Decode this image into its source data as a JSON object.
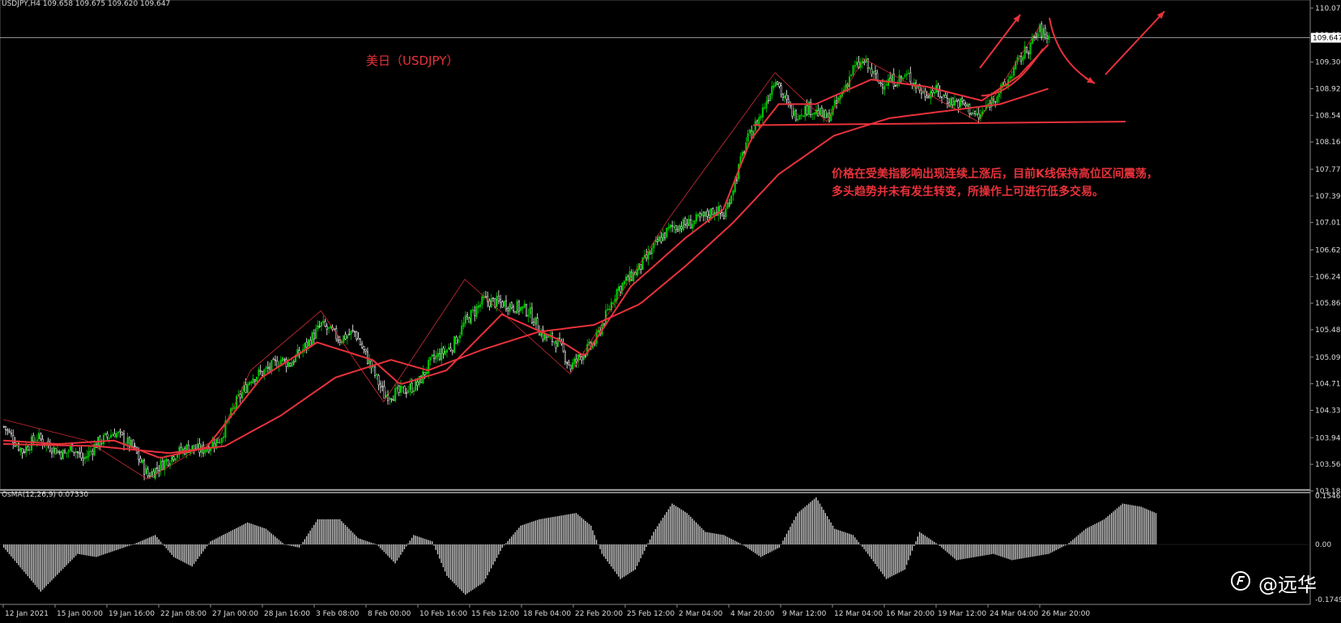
{
  "header": {
    "symbol_line": "USDJPY,H4  109.658 109.675 109.620 109.647",
    "oscillator_line": "OsMA(12,26,9) 0.07330"
  },
  "annotations": {
    "title": "美日（USDJPY）",
    "note_line_1": "价格在受美指影响出现连续上涨后，目前K线保持高位区间震荡，",
    "note_line_2": "多头趋势并未有发生转变，所操作上可进行低多交易。"
  },
  "watermark": {
    "text": "@远华"
  },
  "colors": {
    "background": "#000000",
    "bull_candle": "#00c800",
    "bear_candle": "#ffffff",
    "moving_average": "#e8323b",
    "annotation": "#e8323b",
    "histogram": "#c8c8c8",
    "price_line": "#c0c0c0"
  },
  "chart_data": [
    {
      "type": "candlestick",
      "title": "USDJPY,H4",
      "timeframe": "H4",
      "last_quote": {
        "open": 109.658,
        "high": 109.675,
        "low": 109.62,
        "close": 109.647
      },
      "current_price_label": "109.647",
      "ylim": [
        103.18,
        110.07
      ],
      "y_ticks": [
        "110.070",
        "109.690",
        "109.300",
        "108.920",
        "108.540",
        "108.160",
        "107.770",
        "107.390",
        "107.010",
        "106.620",
        "106.240",
        "105.860",
        "105.480",
        "105.090",
        "104.710",
        "104.330",
        "103.940",
        "103.560",
        "103.180"
      ],
      "x_ticks": [
        "12 Jan 2021",
        "15 Jan 00:00",
        "19 Jan 16:00",
        "22 Jan 08:00",
        "27 Jan 00:00",
        "28 Jan 16:00",
        "3 Feb 08:00",
        "8 Feb 00:00",
        "10 Feb 16:00",
        "15 Feb 12:00",
        "18 Feb 04:00",
        "22 Feb 20:00",
        "25 Feb 12:00",
        "2 Mar 04:00",
        "4 Mar 20:00",
        "9 Mar 12:00",
        "12 Mar 04:00",
        "16 Mar 20:00",
        "19 Mar 12:00",
        "24 Mar 04:00",
        "26 Mar 20:00"
      ],
      "price_path": [
        [
          0,
          104.1
        ],
        [
          10,
          103.75
        ],
        [
          18,
          103.95
        ],
        [
          27,
          103.78
        ],
        [
          33,
          103.7
        ],
        [
          37,
          103.82
        ],
        [
          43,
          103.62
        ],
        [
          50,
          103.85
        ],
        [
          60,
          104.02
        ],
        [
          70,
          103.8
        ],
        [
          78,
          103.4
        ],
        [
          85,
          103.55
        ],
        [
          92,
          103.7
        ],
        [
          100,
          103.8
        ],
        [
          107,
          103.76
        ],
        [
          117,
          103.92
        ],
        [
          126,
          104.45
        ],
        [
          134,
          104.8
        ],
        [
          142,
          104.9
        ],
        [
          150,
          105.05
        ],
        [
          155,
          105.0
        ],
        [
          162,
          105.2
        ],
        [
          172,
          105.55
        ],
        [
          182,
          105.35
        ],
        [
          190,
          105.45
        ],
        [
          199,
          104.95
        ],
        [
          206,
          104.55
        ],
        [
          214,
          104.58
        ],
        [
          224,
          104.7
        ],
        [
          232,
          105.05
        ],
        [
          243,
          105.25
        ],
        [
          250,
          105.6
        ],
        [
          260,
          105.9
        ],
        [
          272,
          105.85
        ],
        [
          284,
          105.75
        ],
        [
          292,
          105.4
        ],
        [
          300,
          105.3
        ],
        [
          307,
          104.95
        ],
        [
          312,
          105.1
        ],
        [
          320,
          105.3
        ],
        [
          332,
          106.05
        ],
        [
          344,
          106.35
        ],
        [
          356,
          106.8
        ],
        [
          362,
          106.95
        ],
        [
          372,
          107.0
        ],
        [
          380,
          107.1
        ],
        [
          385,
          107.2
        ],
        [
          390,
          107.1
        ],
        [
          396,
          107.6
        ],
        [
          402,
          108.15
        ],
        [
          410,
          108.55
        ],
        [
          418,
          109.1
        ],
        [
          422,
          108.8
        ],
        [
          428,
          108.55
        ],
        [
          436,
          108.65
        ],
        [
          446,
          108.5
        ],
        [
          452,
          108.75
        ],
        [
          460,
          109.2
        ],
        [
          466,
          109.3
        ],
        [
          474,
          109.0
        ],
        [
          484,
          109.05
        ],
        [
          490,
          109.1
        ],
        [
          498,
          108.85
        ],
        [
          504,
          108.9
        ],
        [
          512,
          108.75
        ],
        [
          520,
          108.7
        ],
        [
          528,
          108.5
        ],
        [
          536,
          108.8
        ],
        [
          542,
          108.95
        ],
        [
          548,
          109.25
        ],
        [
          556,
          109.55
        ],
        [
          561,
          109.75
        ],
        [
          566,
          109.65
        ]
      ],
      "moving_averages": [
        {
          "name": "",
          "path": [
            [
              0,
              103.9
            ],
            [
              30,
              103.85
            ],
            [
              60,
              103.9
            ],
            [
              85,
              103.65
            ],
            [
              110,
              103.8
            ],
            [
              140,
              104.8
            ],
            [
              170,
              105.3
            ],
            [
              200,
              105.05
            ],
            [
              215,
              104.7
            ],
            [
              240,
              104.9
            ],
            [
              270,
              105.7
            ],
            [
              300,
              105.35
            ],
            [
              315,
              105.1
            ],
            [
              340,
              106.1
            ],
            [
              370,
              106.8
            ],
            [
              390,
              107.2
            ],
            [
              405,
              108.2
            ],
            [
              420,
              108.7
            ],
            [
              440,
              108.7
            ],
            [
              470,
              109.05
            ],
            [
              500,
              108.95
            ],
            [
              530,
              108.75
            ],
            [
              550,
              109.1
            ],
            [
              566,
              109.55
            ]
          ]
        },
        {
          "name": "",
          "path": [
            [
              0,
              103.85
            ],
            [
              50,
              103.82
            ],
            [
              90,
              103.72
            ],
            [
              120,
              103.82
            ],
            [
              150,
              104.25
            ],
            [
              180,
              104.8
            ],
            [
              210,
              105.05
            ],
            [
              230,
              104.9
            ],
            [
              260,
              105.2
            ],
            [
              290,
              105.45
            ],
            [
              320,
              105.55
            ],
            [
              345,
              105.85
            ],
            [
              370,
              106.4
            ],
            [
              395,
              107.0
            ],
            [
              420,
              107.7
            ],
            [
              450,
              108.25
            ],
            [
              480,
              108.5
            ],
            [
              510,
              108.6
            ],
            [
              540,
              108.7
            ],
            [
              566,
              108.92
            ]
          ]
        }
      ]
    },
    {
      "type": "bar",
      "title": "OsMA(12,26,9)",
      "last_value": 0.0733,
      "ylim": [
        -0.17497,
        0.15465
      ],
      "y_ticks": [
        "0.15465",
        "0.00",
        "-0.17497"
      ],
      "profile": [
        [
          0,
          -0.01
        ],
        [
          10,
          -0.08
        ],
        [
          20,
          -0.15
        ],
        [
          30,
          -0.09
        ],
        [
          40,
          -0.03
        ],
        [
          50,
          -0.04
        ],
        [
          60,
          -0.02
        ],
        [
          70,
          0.0
        ],
        [
          82,
          0.03
        ],
        [
          92,
          -0.04
        ],
        [
          102,
          -0.07
        ],
        [
          112,
          0.01
        ],
        [
          122,
          0.04
        ],
        [
          132,
          0.07
        ],
        [
          142,
          0.05
        ],
        [
          152,
          0.0
        ],
        [
          160,
          -0.01
        ],
        [
          170,
          0.08
        ],
        [
          182,
          0.08
        ],
        [
          192,
          0.02
        ],
        [
          202,
          0.0
        ],
        [
          212,
          -0.06
        ],
        [
          222,
          0.03
        ],
        [
          232,
          0.01
        ],
        [
          240,
          -0.1
        ],
        [
          250,
          -0.16
        ],
        [
          260,
          -0.12
        ],
        [
          270,
          -0.01
        ],
        [
          280,
          0.06
        ],
        [
          290,
          0.08
        ],
        [
          300,
          0.09
        ],
        [
          310,
          0.1
        ],
        [
          318,
          0.06
        ],
        [
          324,
          -0.03
        ],
        [
          334,
          -0.11
        ],
        [
          342,
          -0.08
        ],
        [
          352,
          0.04
        ],
        [
          362,
          0.13
        ],
        [
          370,
          0.1
        ],
        [
          380,
          0.04
        ],
        [
          390,
          0.03
        ],
        [
          400,
          0.0
        ],
        [
          410,
          -0.04
        ],
        [
          420,
          -0.01
        ],
        [
          430,
          0.1
        ],
        [
          440,
          0.15
        ],
        [
          450,
          0.05
        ],
        [
          460,
          0.03
        ],
        [
          468,
          -0.03
        ],
        [
          478,
          -0.11
        ],
        [
          488,
          -0.08
        ],
        [
          496,
          0.04
        ],
        [
          506,
          0.0
        ],
        [
          516,
          -0.05
        ],
        [
          526,
          -0.04
        ],
        [
          536,
          -0.03
        ],
        [
          546,
          -0.05
        ],
        [
          556,
          -0.04
        ],
        [
          566,
          -0.03
        ],
        [
          576,
          0.0
        ],
        [
          586,
          0.05
        ],
        [
          596,
          0.08
        ],
        [
          606,
          0.13
        ],
        [
          616,
          0.12
        ],
        [
          624,
          0.1
        ]
      ]
    }
  ]
}
